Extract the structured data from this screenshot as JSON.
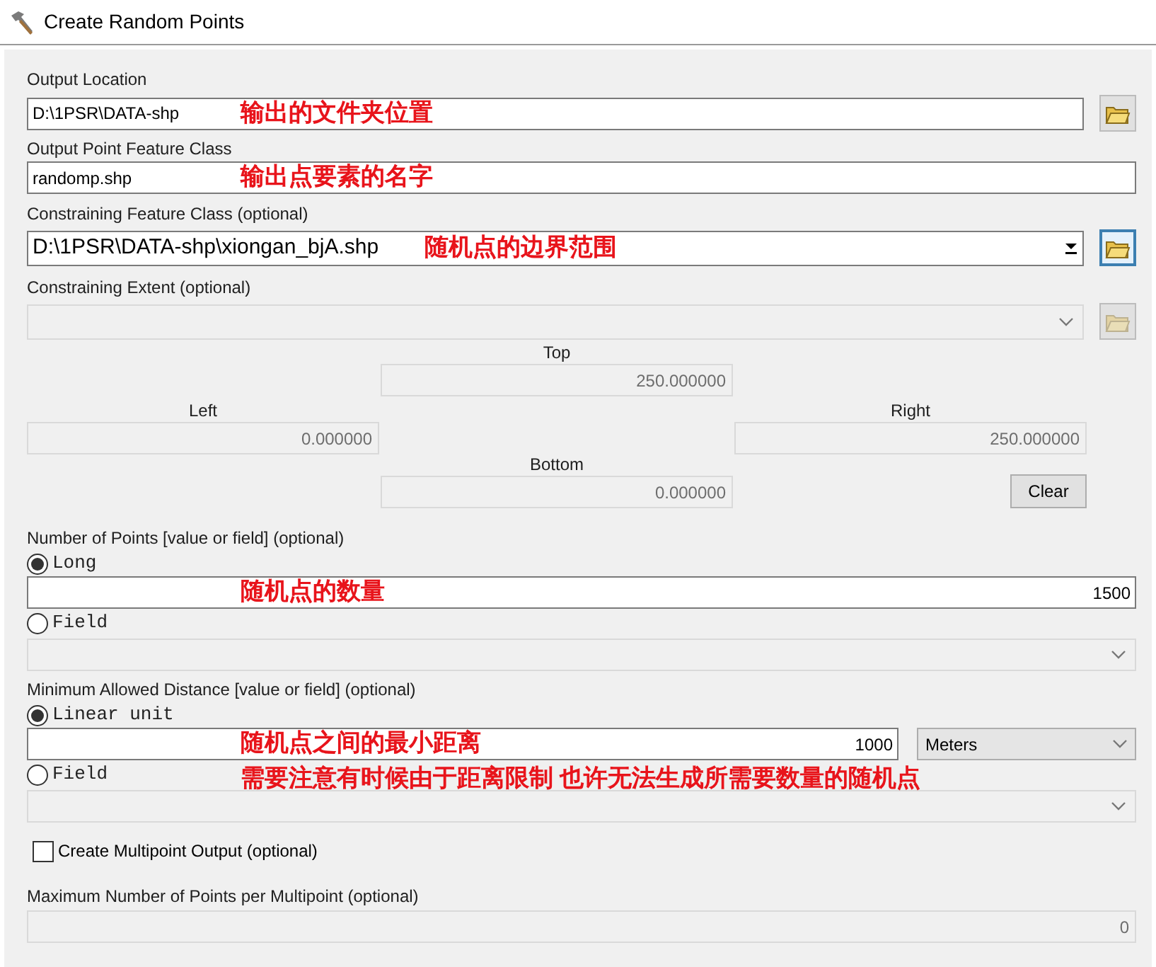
{
  "window": {
    "title": "Create Random Points"
  },
  "output_location": {
    "label": "Output Location",
    "value": "D:\\1PSR\\DATA-shp",
    "annotation": "输出的文件夹位置"
  },
  "output_point_feature_class": {
    "label": "Output Point Feature Class",
    "value": "randomp.shp",
    "annotation": "输出点要素的名字"
  },
  "constraining_feature_class": {
    "label": "Constraining Feature Class (optional)",
    "value": "D:\\1PSR\\DATA-shp\\xiongan_bjA.shp",
    "annotation": "随机点的边界范围"
  },
  "constraining_extent": {
    "label": "Constraining Extent (optional)",
    "disabled": true,
    "top": {
      "label": "Top",
      "value": "250.000000"
    },
    "left": {
      "label": "Left",
      "value": "0.000000"
    },
    "right": {
      "label": "Right",
      "value": "250.000000"
    },
    "bottom": {
      "label": "Bottom",
      "value": "0.000000"
    },
    "clear_button": "Clear"
  },
  "number_of_points": {
    "label": "Number of Points [value or field] (optional)",
    "options": [
      {
        "label": "Long",
        "selected": true
      },
      {
        "label": "Field",
        "selected": false
      }
    ],
    "value": "1500",
    "annotation": "随机点的数量"
  },
  "minimum_allowed_distance": {
    "label": "Minimum Allowed Distance [value or field] (optional)",
    "options": [
      {
        "label": "Linear unit",
        "selected": true
      },
      {
        "label": "Field",
        "selected": false
      }
    ],
    "value": "1000",
    "unit": "Meters",
    "annotations": [
      "随机点之间的最小距离",
      "需要注意有时候由于距离限制 也许无法生成所需要数量的随机点"
    ]
  },
  "create_multipoint": {
    "label": "Create Multipoint Output (optional)",
    "checked": false
  },
  "maximum_points_per_multipoint": {
    "label": "Maximum Number of Points per Multipoint (optional)",
    "value": "0"
  }
}
